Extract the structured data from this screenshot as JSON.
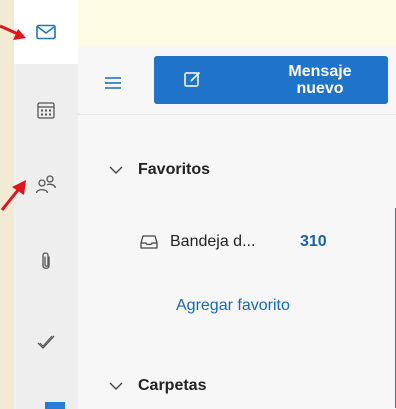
{
  "rail": {
    "items": [
      {
        "icon": "mail-icon",
        "active": true
      },
      {
        "icon": "calendar-icon",
        "active": false
      },
      {
        "icon": "people-icon",
        "active": false
      },
      {
        "icon": "paperclip-icon",
        "active": false
      },
      {
        "icon": "check-icon",
        "active": false
      }
    ]
  },
  "toolbar": {
    "new_message_label": "Mensaje nuevo"
  },
  "folders": {
    "favorites_label": "Favoritos",
    "inbox_label": "Bandeja d...",
    "inbox_count": "310",
    "add_favorite_label": "Agregar favorito",
    "folders_label": "Carpetas"
  },
  "colors": {
    "accent": "#1f73c8",
    "link": "#1a67b8",
    "annotation_arrow": "#e0121a"
  }
}
